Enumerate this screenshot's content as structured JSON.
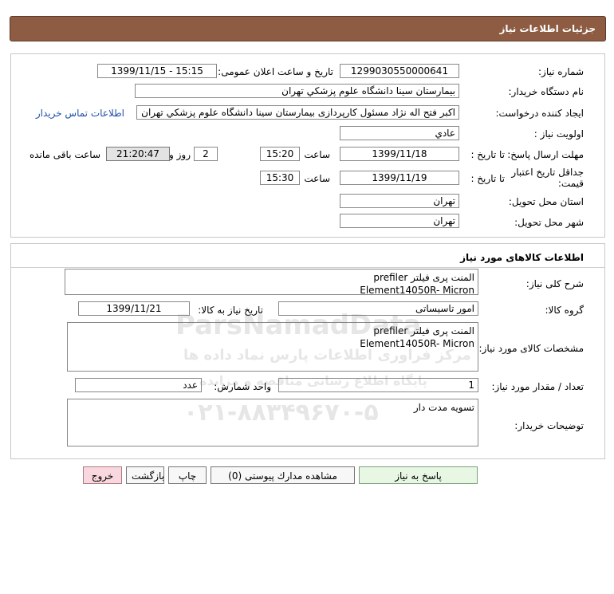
{
  "header": {
    "title": "جزئيات اطلاعات نياز"
  },
  "details": {
    "need_number_label": "شماره نياز:",
    "need_number": "1299030550000641",
    "announce_label": "تاريخ و ساعت اعلان عمومی:",
    "announce_value": "1399/11/15 - 15:15",
    "buyer_label": "نام دستگاه خريدار:",
    "buyer_value": "بيمارستان سينا دانشگاه علوم پزشكي تهران",
    "creator_label": "ايجاد كننده درخواست:",
    "creator_value": "اكبر  فتح اله نژاد  مسئول كارپردازی  بيمارستان سينا دانشگاه علوم پزشكي تهران",
    "contact_link": "اطلاعات تماس خريدار",
    "priority_label": "اولويت نياز :",
    "priority_value": "عادي",
    "deadline_label": "مهلت ارسال پاسخ:",
    "until_date_label": "تا تاريخ :",
    "deadline_date": "1399/11/18",
    "time_label": "ساعت",
    "deadline_time": "15:20",
    "days_value": "2",
    "days_and_label": "روز و",
    "remaining_time": "21:20:47",
    "remaining_label": "ساعت باقی مانده",
    "validity_label_1": "جداقل تاريخ اعتبار",
    "validity_label_2": "قيمت:",
    "validity_date": "1399/11/19",
    "validity_time": "15:30",
    "province_label": "استان محل تحويل:",
    "province_value": "تهران",
    "city_label": "شهر محل تحويل:",
    "city_value": "تهران"
  },
  "goods": {
    "section_title": "اطلاعات كالاهای مورد نياز",
    "summary_label": "شرح كلی نياز:",
    "summary_value": "المنت پری فیلتر prefiler\nElement14050R- Micron",
    "group_label": "گروه كالا:",
    "group_value": "امور تاسيساتی",
    "need_date_label": "تاريخ نياز به كالا:",
    "need_date_value": "1399/11/21",
    "specs_label": "مشخصات كالای مورد نياز:",
    "specs_value": "المنت پری فیلتر prefiler\nElement14050R- Micron",
    "qty_label": "تعداد / مقدار مورد نياز:",
    "qty_value": "1",
    "unit_label": "واحد شمارش:",
    "unit_value": "عدد",
    "buyer_notes_label": "توضيحات خريدار:",
    "buyer_notes_value": "تسويه مدت دار"
  },
  "buttons": {
    "respond": "پاسخ به نياز",
    "view_docs": "مشاهده مدارك پيوستی (0)",
    "print": "چاپ",
    "back": "بازگشت",
    "exit": "خروج"
  },
  "watermark": {
    "brand": "ParsNamadData",
    "line1": "مرکز فراوری اطلاعات پارس نماد داده ها",
    "line2": "پایگاه اطلاع رسانی مناقصه و مزایده",
    "phone": "۰۲۱-۸۸۳۴۹۶۷۰-۵"
  }
}
